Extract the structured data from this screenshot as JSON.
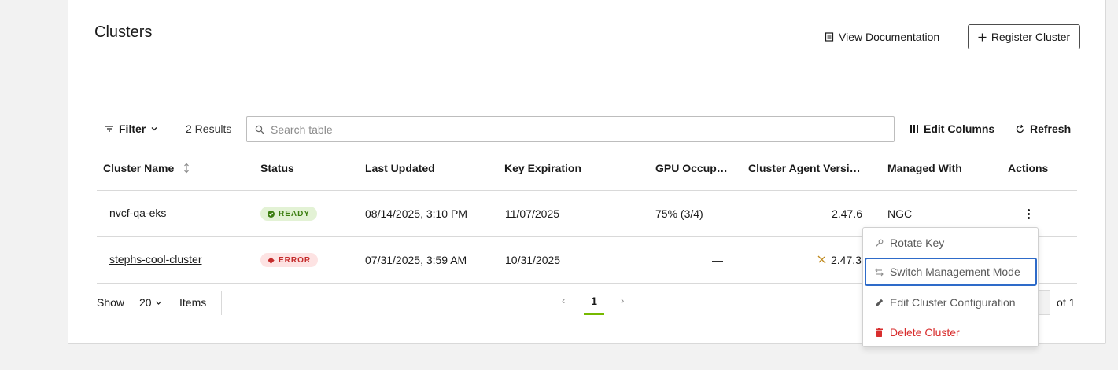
{
  "page": {
    "title": "Clusters"
  },
  "header": {
    "view_docs_label": "View Documentation",
    "register_label": "Register Cluster"
  },
  "toolbar": {
    "filter_label": "Filter",
    "results_label": "2 Results",
    "search_placeholder": "Search table",
    "edit_columns_label": "Edit Columns",
    "refresh_label": "Refresh"
  },
  "table": {
    "columns": [
      "Cluster Name",
      "Status",
      "Last Updated",
      "Key Expiration",
      "GPU Occup…",
      "Cluster Agent Versi…",
      "Managed With",
      "Actions"
    ],
    "rows": [
      {
        "name": "nvcf-qa-eks",
        "status": "READY",
        "last_updated": "08/14/2025, 3:10 PM",
        "key_expiration": "11/07/2025",
        "gpu_occupancy": "75% (3/4)",
        "agent_version": "2.47.6",
        "managed_with": "NGC"
      },
      {
        "name": "stephs-cool-cluster",
        "status": "ERROR",
        "last_updated": "07/31/2025, 3:59 AM",
        "key_expiration": "10/31/2025",
        "gpu_occupancy": "—",
        "agent_version": "2.47.3",
        "managed_with": ""
      }
    ]
  },
  "footer": {
    "show_label": "Show",
    "page_size": "20",
    "items_label": "Items",
    "current_page": "1",
    "of_label": "of 1"
  },
  "actions_menu": {
    "items": [
      {
        "label": "Rotate Key",
        "icon": "key-icon"
      },
      {
        "label": "Switch Management Mode",
        "icon": "switch-arrows-icon"
      },
      {
        "label": "Edit Cluster Configuration",
        "icon": "pencil-icon"
      },
      {
        "label": "Delete Cluster",
        "icon": "trash-icon"
      }
    ]
  },
  "colors": {
    "accent_green": "#76b900",
    "ready_bg": "#e3f2d5",
    "ready_text": "#3d7f12",
    "error_bg": "#fde3e3",
    "error_text": "#c42b2b",
    "focus_blue": "#2e6bc9",
    "danger_red": "#d82e2e"
  }
}
